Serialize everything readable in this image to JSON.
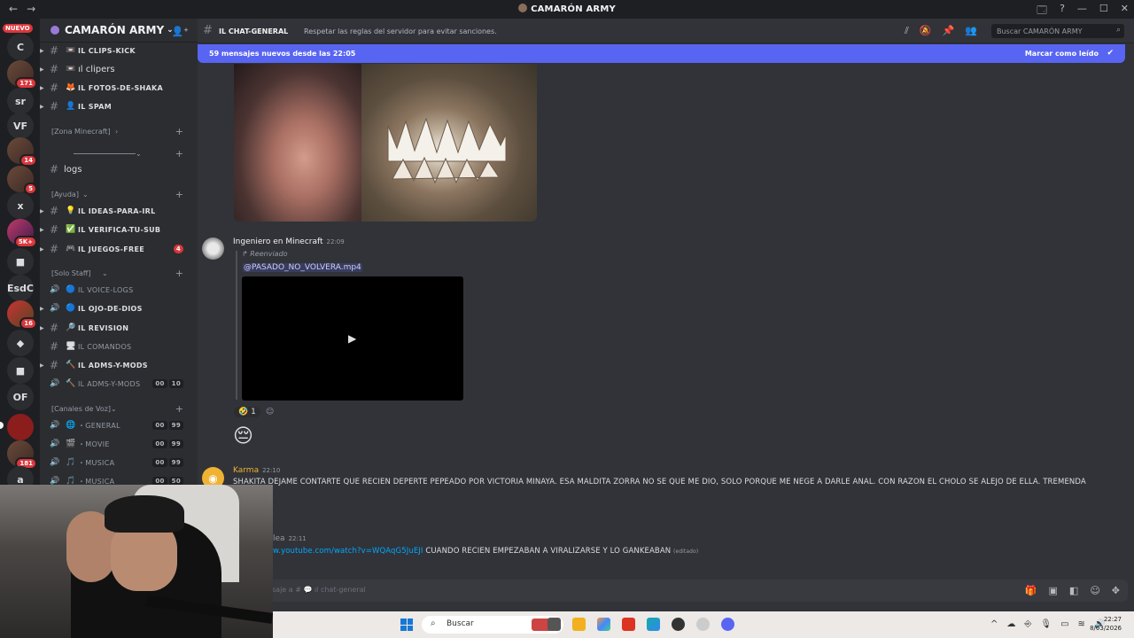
{
  "window": {
    "title": "CAMARÓN ARMY",
    "back": "←",
    "forward": "→",
    "controls": [
      "🗔",
      "?",
      "—",
      "☐",
      "✕"
    ]
  },
  "rail": {
    "new_badge": "NUEVO",
    "servers": [
      {
        "label": "C",
        "badge": ""
      },
      {
        "label": "",
        "badge": "171"
      },
      {
        "label": "sr",
        "badge": ""
      },
      {
        "label": "VF",
        "badge": ""
      },
      {
        "label": "",
        "badge": "14"
      },
      {
        "label": "",
        "badge": "5"
      },
      {
        "label": "x",
        "badge": ""
      },
      {
        "label": "",
        "badge": "5K+"
      },
      {
        "label": "■",
        "badge": ""
      },
      {
        "label": "EsdC",
        "badge": ""
      },
      {
        "label": "",
        "badge": "16"
      },
      {
        "label": "◆",
        "badge": ""
      },
      {
        "label": "■",
        "badge": ""
      },
      {
        "label": "OF",
        "badge": ""
      },
      {
        "label": "",
        "badge": ""
      },
      {
        "label": "",
        "badge": "181"
      },
      {
        "label": "a",
        "badge": ""
      }
    ]
  },
  "sidebar": {
    "server_name": "CAMARÓN ARMY",
    "channels_top": [
      {
        "emoji": "📼",
        "name": "ıl clips-kick",
        "style": "bold"
      },
      {
        "emoji": "📼",
        "name": "ıl clipers",
        "style": "lower"
      },
      {
        "emoji": "🦊",
        "name": "ıl fotos-de-shaka",
        "style": "bold"
      },
      {
        "emoji": "👤",
        "name": "ıl spam",
        "style": "bold"
      }
    ],
    "cat_minecraft": "[Zona Minecraft]",
    "cat_ayuda": "[Ayuda]",
    "cat_staff": "[Solo Staff]",
    "cat_voz": "[Canales de Voz]",
    "logs": "logs",
    "channels_ayuda": [
      {
        "emoji": "💡",
        "name": "ıl ideas-para-irl",
        "mention": ""
      },
      {
        "emoji": "✅",
        "name": "ıl verifica-tu-sub",
        "mention": ""
      },
      {
        "emoji": "🎮",
        "name": "ıl juegos-free",
        "mention": "4"
      }
    ],
    "channels_staff": [
      {
        "emoji": "🔵",
        "name": "ıl voice-logs",
        "dim": true
      },
      {
        "emoji": "🔵",
        "name": "ıl ojo-de-dios",
        "dim": false
      },
      {
        "emoji": "🔎",
        "name": "ıl revision",
        "dim": false
      },
      {
        "emoji": "🖥",
        "name": "ıl comandos",
        "dim": true
      },
      {
        "emoji": "🔨",
        "name": "ıl adms-y-mods",
        "dim": false
      },
      {
        "emoji": "🔨",
        "name": "ıl adms-y-mods",
        "dim": true,
        "cnt": [
          "00",
          "10"
        ]
      }
    ],
    "channels_voz": [
      {
        "emoji": "🌐",
        "name": "・general",
        "cnt": [
          "00",
          "99"
        ]
      },
      {
        "emoji": "🎬",
        "name": "・movie",
        "cnt": [
          "00",
          "99"
        ]
      },
      {
        "emoji": "🎵",
        "name": "・musica",
        "cnt": [
          "00",
          "99"
        ]
      },
      {
        "emoji": "🎵",
        "name": "・musica",
        "cnt": [
          "00",
          "50"
        ]
      }
    ]
  },
  "header": {
    "channel": "ıl chat-general",
    "topic": "Respetar las reglas del servidor para evitar sanciones.",
    "search_placeholder": "Buscar CAMARÓN ARMY"
  },
  "newbar": {
    "text": "59 mensajes nuevos desde las 22:05",
    "mark_read": "Marcar como leído"
  },
  "messages": {
    "m1": {
      "author": "Ingeniero en Minecraft",
      "time": "22:09",
      "forwarded": "↱ Reenviado",
      "file": "@PASADO_NO_VOLVERA.mp4",
      "reaction_emoji": "🤣",
      "reaction_count": "1"
    },
    "big_emoji": "😔",
    "m2": {
      "author": "Karma",
      "time": "22:10",
      "text": "SHAKITA DEJAME CONTARTE QUE RECIEN DEPERTE PEPEADO POR VICTORIA MINAYA. ESA MALDITA ZORRA NO SE QUE ME DIO, SOLO PORQUE ME NEGE A DARLE ANAL. CON RAZON EL CHOLO SE ALEJO DE ELLA. TREMENDA"
    },
    "m3": {
      "author": "lea",
      "time": "22:11",
      "link": "w.youtube.com/watch?v=WQAqG5JuEJI",
      "text": " CUANDO RECIEN EMPEZABAN A VIRALIZARSE Y LO GANKEABAN ",
      "edited": "(editado)"
    }
  },
  "composer": {
    "placeholder": "saje a # 💬 ıl chat-general"
  },
  "taskbar": {
    "search": "Buscar",
    "time": "22:27",
    "date": "8/03/2026"
  }
}
